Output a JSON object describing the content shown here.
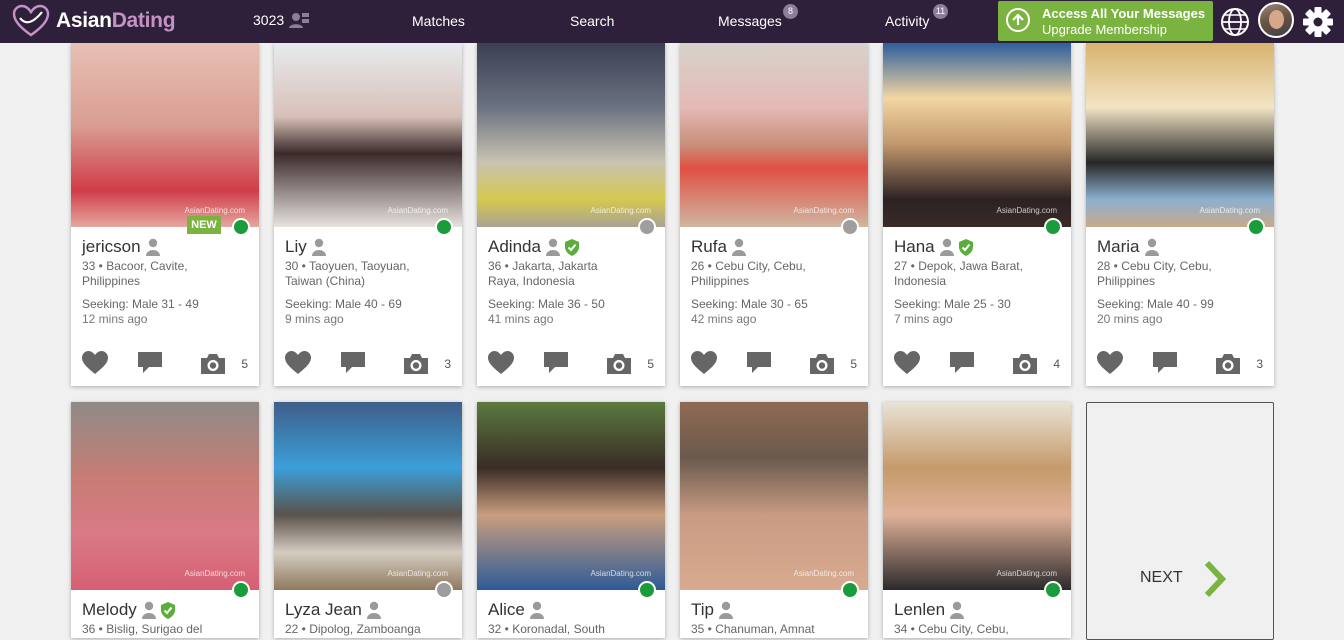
{
  "brand": {
    "part1": "Asian",
    "part2": "Dating",
    "accent": "#c493c4"
  },
  "nav": {
    "online_count": "3023",
    "matches": "Matches",
    "search": "Search",
    "messages": "Messages",
    "messages_badge": "8",
    "activity": "Activity",
    "activity_badge": "11"
  },
  "upgrade": {
    "line1": "Access All Your Messages",
    "line2": "Upgrade Membership",
    "color": "#7ab33f"
  },
  "watermark": "AsianDating.com",
  "new_label": "NEW",
  "colors": {
    "online": "#1a9b3c",
    "offline": "#9e9e9e",
    "header_bg": "#2e1f3a"
  },
  "profiles": [
    {
      "name": "jericson",
      "verified": false,
      "new": true,
      "online": true,
      "line1": "33 • Bacoor, Cavite,",
      "line2": "Philippines",
      "seeking": "Seeking: Male 31 - 49",
      "ago": "12 mins ago",
      "photos": "5"
    },
    {
      "name": "Liy",
      "verified": false,
      "new": false,
      "online": true,
      "line1": "30 • Taoyuen, Taoyuan,",
      "line2": "Taiwan (China)",
      "seeking": "Seeking: Male 40 - 69",
      "ago": "9 mins ago",
      "photos": "3"
    },
    {
      "name": "Adinda",
      "verified": true,
      "new": false,
      "online": false,
      "line1": "36 • Jakarta, Jakarta",
      "line2": "Raya, Indonesia",
      "seeking": "Seeking: Male 36 - 50",
      "ago": "41 mins ago",
      "photos": "5"
    },
    {
      "name": "Rufa",
      "verified": false,
      "new": false,
      "online": false,
      "line1": "26 • Cebu City, Cebu,",
      "line2": "Philippines",
      "seeking": "Seeking: Male 30 - 65",
      "ago": "42 mins ago",
      "photos": "5"
    },
    {
      "name": "Hana",
      "verified": true,
      "new": false,
      "online": true,
      "line1": "27 • Depok, Jawa Barat,",
      "line2": "Indonesia",
      "seeking": "Seeking: Male 25 - 30",
      "ago": "7 mins ago",
      "photos": "4"
    },
    {
      "name": "Maria",
      "verified": false,
      "new": false,
      "online": true,
      "line1": "28 • Cebu City, Cebu,",
      "line2": "Philippines",
      "seeking": "Seeking: Male 40 - 99",
      "ago": "20 mins ago",
      "photos": "3"
    },
    {
      "name": "Melody",
      "verified": true,
      "new": false,
      "online": true,
      "line1": "36 • Bislig, Surigao del",
      "line2": "",
      "seeking": "",
      "ago": "",
      "photos": ""
    },
    {
      "name": "Lyza Jean",
      "verified": false,
      "new": false,
      "online": false,
      "line1": "22 • Dipolog, Zamboanga",
      "line2": "",
      "seeking": "",
      "ago": "",
      "photos": ""
    },
    {
      "name": "Alice",
      "verified": false,
      "new": false,
      "online": true,
      "line1": "32 • Koronadal, South",
      "line2": "",
      "seeking": "",
      "ago": "",
      "photos": ""
    },
    {
      "name": "Tip",
      "verified": false,
      "new": false,
      "online": true,
      "line1": "35 • Chanuman, Amnat",
      "line2": "",
      "seeking": "",
      "ago": "",
      "photos": ""
    },
    {
      "name": "Lenlen",
      "verified": false,
      "new": false,
      "online": true,
      "line1": "34 • Cebu City, Cebu,",
      "line2": "",
      "seeking": "",
      "ago": "",
      "photos": ""
    }
  ],
  "next": {
    "label": "NEXT"
  }
}
